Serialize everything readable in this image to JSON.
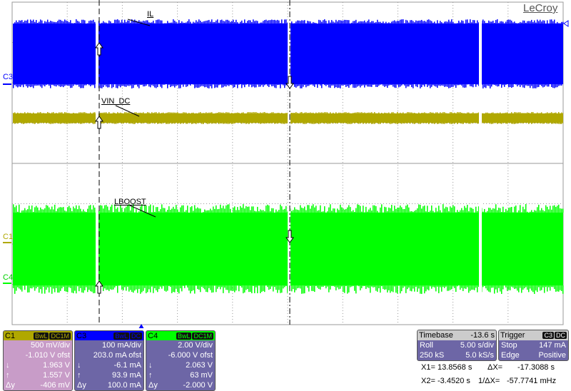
{
  "brand": "LeCroy",
  "traces": {
    "c3": {
      "channel_label": "C3",
      "name": "IL",
      "color": "#0000ff"
    },
    "c1": {
      "channel_label": "C1",
      "name": "VIN_DC",
      "color": "#b0a800"
    },
    "c4": {
      "channel_label": "C4",
      "name": "LBOOST",
      "color": "#00ff00"
    }
  },
  "channels": [
    {
      "id": "C1",
      "color": "#b0a800",
      "bg": "#c89cc8",
      "coupling": [
        "BwL",
        "DC1M"
      ],
      "vdiv": "500 mV/div",
      "offset": "-1.010 V ofst",
      "cursor1": "1.963 V",
      "cursor2": "1.557 V",
      "delta_label": "Δy",
      "delta": "-406 mV"
    },
    {
      "id": "C3",
      "color": "#0000ff",
      "bg": "#6d66a6",
      "coupling": [
        "BwL",
        "DC"
      ],
      "vdiv": "100 mA/div",
      "offset": "203.0 mA ofst",
      "cursor1": "-6.1 mA",
      "cursor2": "93.9 mA",
      "delta_label": "Δy",
      "delta": "100.0 mA"
    },
    {
      "id": "C4",
      "color": "#00ff00",
      "bg": "#6d66a6",
      "coupling": [
        "BwL",
        "DC1M"
      ],
      "vdiv": "2.00 V/div",
      "offset": "-6.000 V ofst",
      "cursor1": "2.063 V",
      "cursor2": "63 mV",
      "delta_label": "Δy",
      "delta": "-2.000 V"
    }
  ],
  "timebase": {
    "title": "Timebase",
    "delay": "-13.6 s",
    "mode": "Roll",
    "tdiv": "5.00 s/div",
    "samples": "250 kS",
    "rate": "5.0 kS/s"
  },
  "trigger": {
    "title": "Trigger",
    "source": "C3",
    "coupling": "DC",
    "state": "Stop",
    "level": "147 mA",
    "type": "Edge",
    "slope": "Positive"
  },
  "cursors": {
    "x1_label": "X1=",
    "x1": "13.8568 s",
    "dx_label": "ΔX=",
    "dx": "-17.3088 s",
    "x2_label": "X2=",
    "x2": "-3.4520 s",
    "inv_dx_label": "1/ΔX=",
    "inv_dx": "-57.7741 mHz"
  }
}
